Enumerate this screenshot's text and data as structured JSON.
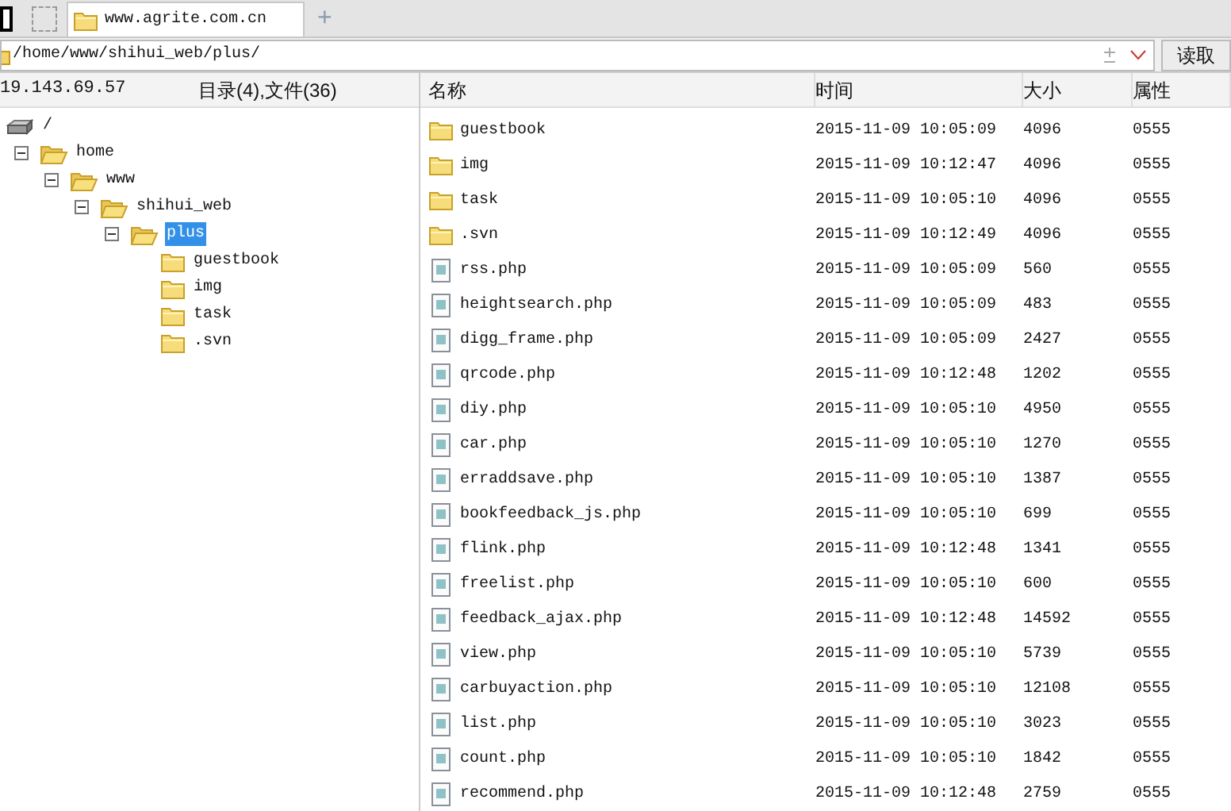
{
  "tabs": [
    {
      "label": "www.agrite.com.cn",
      "selected": true
    }
  ],
  "new_tab": "+",
  "address": {
    "value": "/home/www/shihui_web/plus/",
    "button": "读取"
  },
  "left_header": {
    "host": "19.143.69.57",
    "summary": "目录(4),文件(36)"
  },
  "tree": [
    {
      "label": "/",
      "kind": "drive",
      "selected": false,
      "children": [
        {
          "label": "home",
          "kind": "folder",
          "expanded": true,
          "selected": false,
          "children": [
            {
              "label": "www",
              "kind": "folder",
              "expanded": true,
              "selected": false,
              "children": [
                {
                  "label": "shihui_web",
                  "kind": "folder",
                  "expanded": true,
                  "selected": false,
                  "children": [
                    {
                      "label": "plus",
                      "kind": "folder",
                      "expanded": true,
                      "selected": true,
                      "children": [
                        {
                          "label": "guestbook",
                          "kind": "folder",
                          "selected": false
                        },
                        {
                          "label": "img",
                          "kind": "folder",
                          "selected": false
                        },
                        {
                          "label": "task",
                          "kind": "folder",
                          "selected": false
                        },
                        {
                          "label": ".svn",
                          "kind": "folder",
                          "selected": false
                        }
                      ]
                    }
                  ]
                }
              ]
            }
          ]
        }
      ]
    }
  ],
  "table": {
    "columns": [
      "名称",
      "时间",
      "大小",
      "属性"
    ],
    "rows": [
      {
        "kind": "folder",
        "name": "guestbook",
        "time": "2015-11-09 10:05:09",
        "size": "4096",
        "attr": "0555"
      },
      {
        "kind": "folder",
        "name": "img",
        "time": "2015-11-09 10:12:47",
        "size": "4096",
        "attr": "0555"
      },
      {
        "kind": "folder",
        "name": "task",
        "time": "2015-11-09 10:05:10",
        "size": "4096",
        "attr": "0555"
      },
      {
        "kind": "folder",
        "name": ".svn",
        "time": "2015-11-09 10:12:49",
        "size": "4096",
        "attr": "0555"
      },
      {
        "kind": "file",
        "name": "rss.php",
        "time": "2015-11-09 10:05:09",
        "size": "560",
        "attr": "0555"
      },
      {
        "kind": "file",
        "name": "heightsearch.php",
        "time": "2015-11-09 10:05:09",
        "size": "483",
        "attr": "0555"
      },
      {
        "kind": "file",
        "name": "digg_frame.php",
        "time": "2015-11-09 10:05:09",
        "size": "2427",
        "attr": "0555"
      },
      {
        "kind": "file",
        "name": "qrcode.php",
        "time": "2015-11-09 10:12:48",
        "size": "1202",
        "attr": "0555"
      },
      {
        "kind": "file",
        "name": "diy.php",
        "time": "2015-11-09 10:05:10",
        "size": "4950",
        "attr": "0555"
      },
      {
        "kind": "file",
        "name": "car.php",
        "time": "2015-11-09 10:05:10",
        "size": "1270",
        "attr": "0555"
      },
      {
        "kind": "file",
        "name": "erraddsave.php",
        "time": "2015-11-09 10:05:10",
        "size": "1387",
        "attr": "0555"
      },
      {
        "kind": "file",
        "name": "bookfeedback_js.php",
        "time": "2015-11-09 10:05:10",
        "size": "699",
        "attr": "0555"
      },
      {
        "kind": "file",
        "name": "flink.php",
        "time": "2015-11-09 10:12:48",
        "size": "1341",
        "attr": "0555"
      },
      {
        "kind": "file",
        "name": "freelist.php",
        "time": "2015-11-09 10:05:10",
        "size": "600",
        "attr": "0555"
      },
      {
        "kind": "file",
        "name": "feedback_ajax.php",
        "time": "2015-11-09 10:12:48",
        "size": "14592",
        "attr": "0555"
      },
      {
        "kind": "file",
        "name": "view.php",
        "time": "2015-11-09 10:05:10",
        "size": "5739",
        "attr": "0555"
      },
      {
        "kind": "file",
        "name": "carbuyaction.php",
        "time": "2015-11-09 10:05:10",
        "size": "12108",
        "attr": "0555"
      },
      {
        "kind": "file",
        "name": "list.php",
        "time": "2015-11-09 10:05:10",
        "size": "3023",
        "attr": "0555"
      },
      {
        "kind": "file",
        "name": "count.php",
        "time": "2015-11-09 10:05:10",
        "size": "1842",
        "attr": "0555"
      },
      {
        "kind": "file",
        "name": "recommend.php",
        "time": "2015-11-09 10:12:48",
        "size": "2759",
        "attr": "0555"
      }
    ]
  }
}
